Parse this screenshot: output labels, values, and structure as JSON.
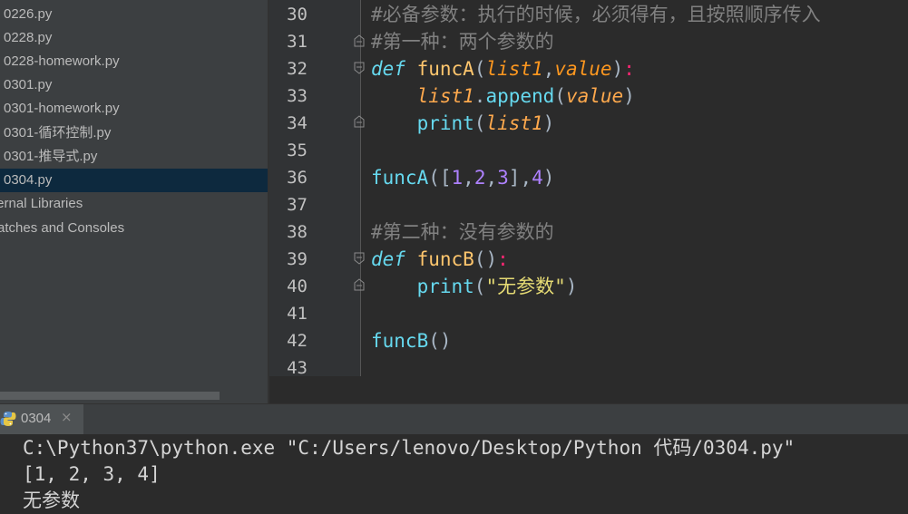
{
  "project_tree": {
    "items": [
      {
        "label": "0226.py",
        "selected": false
      },
      {
        "label": "0228.py",
        "selected": false
      },
      {
        "label": "0228-homework.py",
        "selected": false
      },
      {
        "label": "0301.py",
        "selected": false
      },
      {
        "label": "0301-homework.py",
        "selected": false
      },
      {
        "label": "0301-循环控制.py",
        "selected": false
      },
      {
        "label": "0301-推导式.py",
        "selected": false
      },
      {
        "label": "0304.py",
        "selected": true
      }
    ],
    "roots": [
      {
        "label": "ternal Libraries"
      },
      {
        "label": "ratches and Consoles"
      }
    ]
  },
  "editor": {
    "line_numbers": [
      "30",
      "31",
      "32",
      "33",
      "34",
      "35",
      "36",
      "37",
      "38",
      "39",
      "40",
      "41",
      "42",
      "43"
    ],
    "code": {
      "l30": {
        "comment": "#必备参数：执行的时候，必须得有，且按照顺序传入"
      },
      "l31": {
        "comment": "#第一种：两个参数的"
      },
      "l32": {
        "kw": "def",
        "fn": "funcA",
        "open": "(",
        "p1": "list1",
        "comma": ",",
        "p2": "value",
        "close": ")",
        "colon": ":"
      },
      "l33": {
        "obj": "list1",
        "dot": ".",
        "method": "append",
        "open": "(",
        "arg": "value",
        "close": ")"
      },
      "l34": {
        "fn": "print",
        "open": "(",
        "arg": "list1",
        "close": ")"
      },
      "l36": {
        "fn": "funcA",
        "open": "([",
        "n1": "1",
        "c1": ",",
        "n2": "2",
        "c2": ",",
        "n3": "3",
        "close_list": "],",
        "n4": "4",
        "close": ")"
      },
      "l38": {
        "comment": "#第二种：没有参数的"
      },
      "l39": {
        "kw": "def",
        "fn": "funcB",
        "parens": "()",
        "colon": ":"
      },
      "l40": {
        "fn": "print",
        "open": "(",
        "str": "\"无参数\"",
        "close": ")"
      },
      "l42": {
        "fn": "funcB",
        "parens": "()"
      }
    }
  },
  "run_panel": {
    "tab_label": "0304",
    "close_glyph": "×",
    "output": [
      "C:\\Python37\\python.exe \"C:/Users/lenovo/Desktop/Python 代码/0304.py\"",
      "[1, 2, 3, 4]",
      "无参数"
    ]
  },
  "colors": {
    "panel_bg": "#3c3f41",
    "editor_bg": "#2b2b2b",
    "selection": "#0d293e",
    "comment": "#808080",
    "keyword": "#66d9ef",
    "function": "#ffc66d",
    "parameter": "#fd971f",
    "number": "#ae81ff",
    "string": "#e6db74"
  },
  "icons": {
    "run_tab": "python-icon",
    "fold": "fold-marker-icon",
    "close": "close-icon"
  }
}
